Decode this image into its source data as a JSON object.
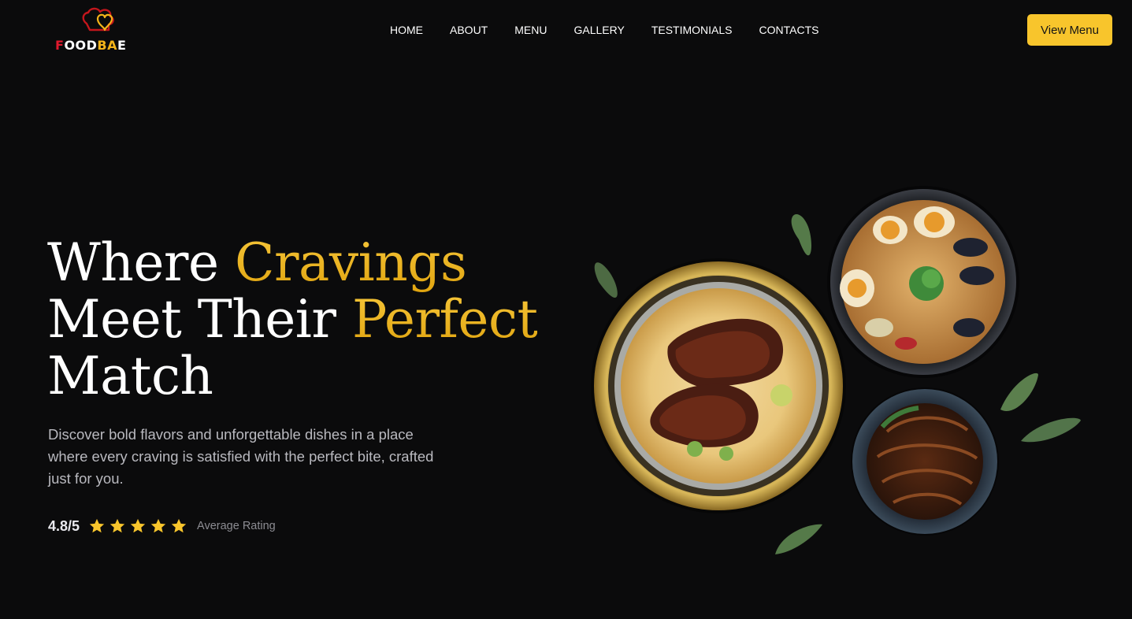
{
  "brand": {
    "name_prefix": "F",
    "name_middle": "OOD",
    "name_accent": "BA",
    "name_suffix": "E",
    "logo_icon": "chef-hat-heart-icon"
  },
  "nav": {
    "items": [
      "HOME",
      "ABOUT",
      "MENU",
      "GALLERY",
      "TESTIMONIALS",
      "CONTACTS"
    ]
  },
  "header": {
    "cta_label": "View Menu"
  },
  "hero": {
    "headline_1": "Where ",
    "headline_1_accent": "Cravings",
    "headline_2": "Meet Their ",
    "headline_2_accent": "Perfect",
    "headline_3": "Match",
    "description": "Discover bold flavors and unforgettable dishes in a place where every craving is satisfied with the perfect bite, crafted just for you.",
    "rating_value": "4.8/5",
    "rating_stars": 5,
    "rating_label": "Average Rating"
  },
  "images": {
    "food": [
      "biryani-with-grilled-fish-plate",
      "ramen-bowl-with-eggs-and-mussels",
      "noodles-bowl",
      "bay-leaves"
    ]
  },
  "colors": {
    "background": "#0b0b0c",
    "accent_gold": "#f3b51c",
    "cta_yellow": "#f8c52c",
    "brand_red": "#e0192d",
    "star_yellow": "#f8c52c",
    "body_text": "#b9b9bf"
  }
}
